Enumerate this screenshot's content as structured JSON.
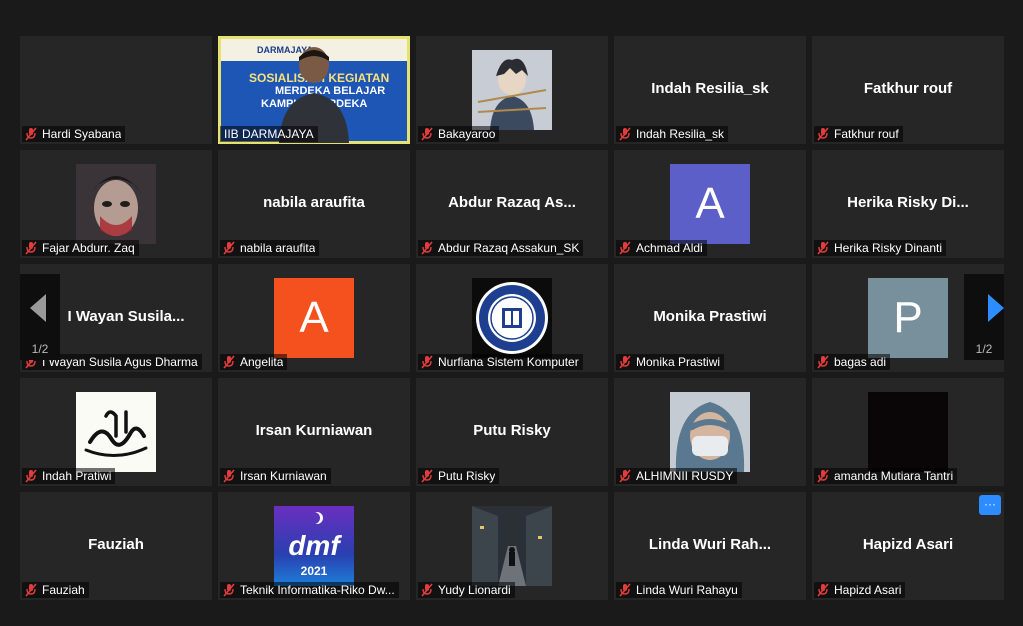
{
  "colors": {
    "muted_mic": "#e23c3c",
    "active_border": "#e6e26f",
    "accent": "#2d8cff"
  },
  "participants": [
    {
      "label": "Hardi Syabana",
      "display": ""
    },
    {
      "label": "IIB DARMAJAYA",
      "display": "",
      "active": true,
      "banner": {
        "org": "DARMAJAYA",
        "line1": "SOSIALISASI KEGIATAN",
        "line2": "MERDEKA BELAJAR",
        "line3": "KAMPUS MERDEKA"
      }
    },
    {
      "label": "Bakayaroo",
      "display": ""
    },
    {
      "label": "Indah Resilia_sk",
      "display": "Indah Resilia_sk"
    },
    {
      "label": "Fatkhur rouf",
      "display": "Fatkhur rouf"
    },
    {
      "label": "Fajar Abdurr. Zaq",
      "display": ""
    },
    {
      "label": "nabila araufita",
      "display": "nabila araufita"
    },
    {
      "label": "Abdur Razaq Assakun_SK",
      "display": "Abdur Razaq As..."
    },
    {
      "label": "Achmad Aldi",
      "display": "",
      "avatar": "A",
      "avatar_color": "#5b5fc7"
    },
    {
      "label": "Herika Risky Dinanti",
      "display": "Herika Risky Di..."
    },
    {
      "label": "I Wayan Susila Agus Dharma",
      "display": "I Wayan Susila..."
    },
    {
      "label": "Angelita",
      "display": "",
      "avatar": "A",
      "avatar_color": "#f4511e"
    },
    {
      "label": "Nurfiana Sistem Komputer",
      "display": ""
    },
    {
      "label": "Monika Prastiwi",
      "display": "Monika Prastiwi"
    },
    {
      "label": "bagas adi",
      "display": "",
      "avatar": "P",
      "avatar_color": "#78909c"
    },
    {
      "label": "Indah Pratiwi",
      "display": ""
    },
    {
      "label": "Irsan Kurniawan",
      "display": "Irsan Kurniawan"
    },
    {
      "label": "Putu Risky",
      "display": "Putu Risky"
    },
    {
      "label": "ALHIMNII RUSDY",
      "display": ""
    },
    {
      "label": "amanda Mutiara Tantri",
      "display": ""
    },
    {
      "label": "Fauziah",
      "display": "Fauziah"
    },
    {
      "label": "Teknik Informatika-Riko Dw...",
      "display": "",
      "logo_text": "dmf",
      "logo_year": "2021"
    },
    {
      "label": "Yudy Lionardi",
      "display": ""
    },
    {
      "label": "Linda Wuri Rahayu",
      "display": "Linda Wuri Rah..."
    },
    {
      "label": "Hapizd Asari",
      "display": "Hapizd Asari",
      "more_label": "···"
    }
  ],
  "pager": {
    "left": "1/2",
    "right": "1/2"
  }
}
